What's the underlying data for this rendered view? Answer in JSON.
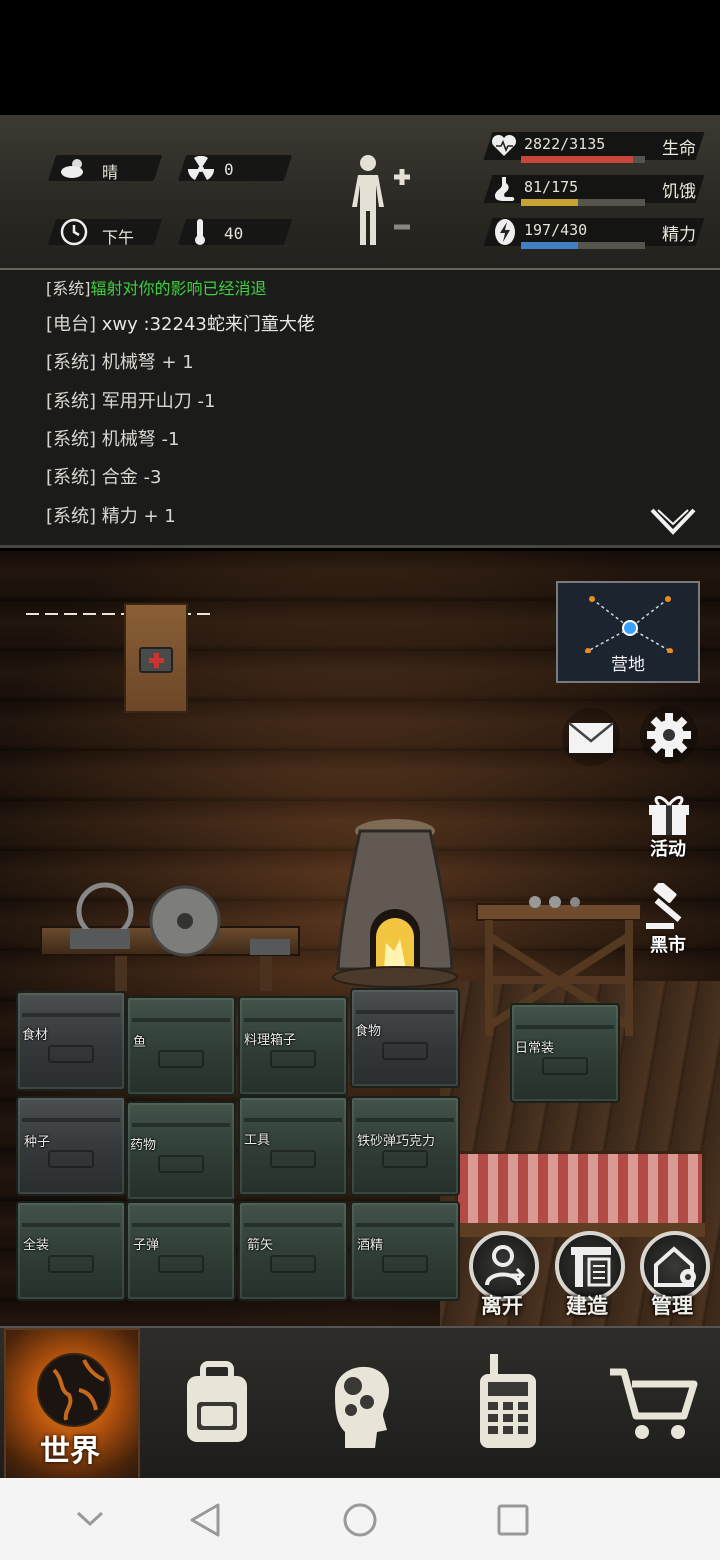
{
  "status": {
    "weather": "晴",
    "radiation": "0",
    "time_of_day": "下午",
    "temperature": "40"
  },
  "vitals": [
    {
      "value": "2822/3135",
      "label": "生命",
      "fraction": 0.9,
      "color": "#c8473a"
    },
    {
      "value": "81/175",
      "label": "饥饿",
      "fraction": 0.46,
      "color": "#c9a236"
    },
    {
      "value": "197/430",
      "label": "精力",
      "fraction": 0.46,
      "color": "#3f7fc2"
    }
  ],
  "log": [
    {
      "tag": "[系统]",
      "text": "辐射对你的影响已经消退",
      "color": "#3fd13f"
    },
    {
      "tag": "[电台]",
      "text": "xwy :32243蛇来门童大佬",
      "color": "#e8e6e0"
    },
    {
      "tag": "[系统]",
      "text": "机械弩 + 1",
      "color": "#d9d6cf"
    },
    {
      "tag": "[系统]",
      "text": "军用开山刀 -1",
      "color": "#d9d6cf"
    },
    {
      "tag": "[系统]",
      "text": "机械弩 -1",
      "color": "#d9d6cf"
    },
    {
      "tag": "[系统]",
      "text": "合金 -3",
      "color": "#d9d6cf"
    },
    {
      "tag": "[系统]",
      "text": "精力 + 1",
      "color": "#d9d6cf"
    }
  ],
  "scene": {
    "minimap_label": "营地",
    "activity_label": "活动",
    "blackmarket_label": "黑市"
  },
  "crates": [
    "食材",
    "鱼",
    "料理箱子",
    "食物",
    "日常装",
    "种子",
    "药物",
    "工具",
    "铁砂弹巧克力",
    "全装",
    "子弹",
    "箭矢",
    "酒精"
  ],
  "actions": {
    "leave": "离开",
    "build": "建造",
    "manage": "管理"
  },
  "nav": {
    "world": "世界"
  }
}
